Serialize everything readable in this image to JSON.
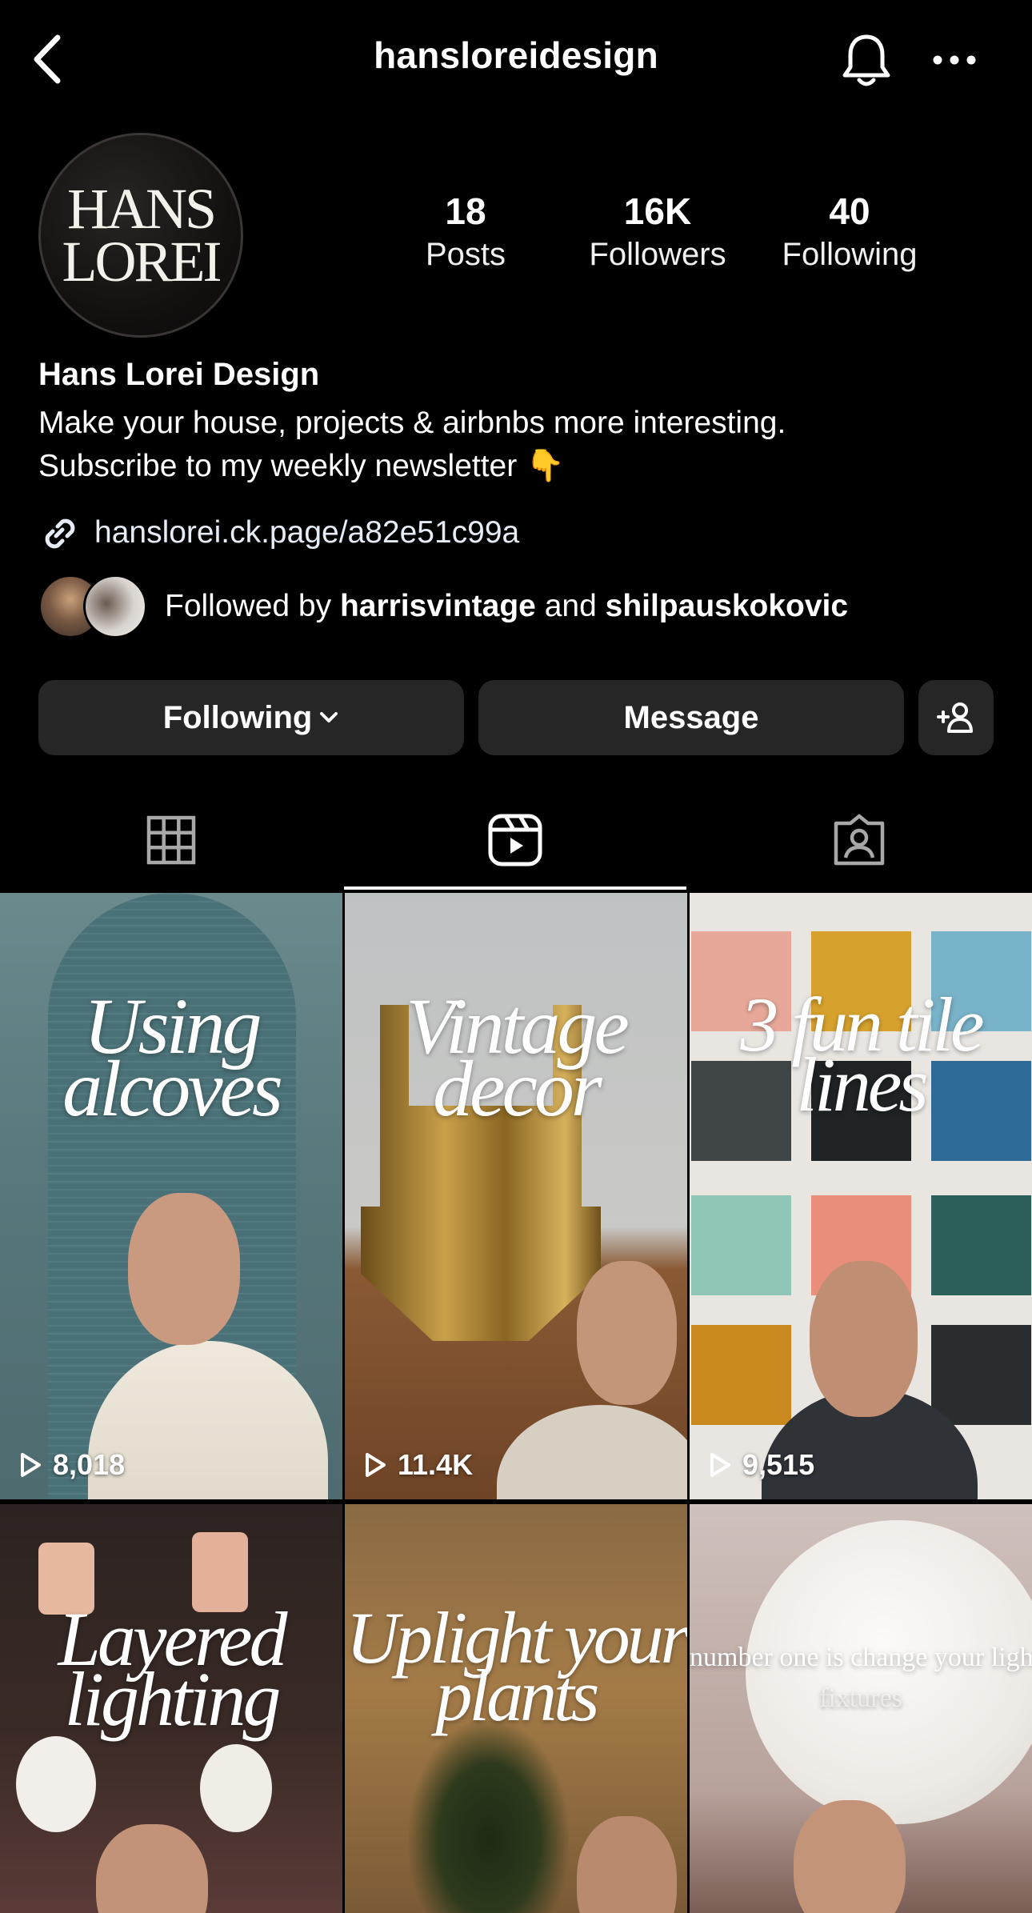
{
  "header": {
    "title": "hansloreidesign",
    "back_icon": "chevron-left-icon",
    "bell_icon": "bell-icon",
    "more_icon": "ellipsis-icon"
  },
  "profile": {
    "avatar_logo_line1": "HANS",
    "avatar_logo_line2": "LOREI",
    "stats": [
      {
        "value": "18",
        "label": "Posts"
      },
      {
        "value": "16K",
        "label": "Followers"
      },
      {
        "value": "40",
        "label": "Following"
      }
    ],
    "name": "Hans Lorei Design",
    "bio_line1": "Make your house, projects & airbnbs more interesting.",
    "bio_line2": "Subscribe to my weekly newsletter 👇",
    "link": "hanslorei.ck.page/a82e51c99a",
    "followed_by_prefix": "Followed by ",
    "followed_by_user1": "harrisvintage",
    "followed_by_and": " and ",
    "followed_by_user2": "shilpauskokovic"
  },
  "actions": {
    "following_label": "Following",
    "message_label": "Message",
    "add_user_icon": "add-person-icon"
  },
  "tabs": [
    {
      "name": "grid",
      "icon": "grid-icon",
      "active": false
    },
    {
      "name": "reels",
      "icon": "reels-icon",
      "active": true
    },
    {
      "name": "tagged",
      "icon": "tagged-icon",
      "active": false
    }
  ],
  "reels": [
    {
      "title_line1": "Using",
      "title_line2": "alcoves",
      "views": "8,018"
    },
    {
      "title_line1": "Vintage",
      "title_line2": "decor",
      "views": "11.4K"
    },
    {
      "title_line1": "3 fun tile",
      "title_line2": "lines",
      "views": "9,515"
    },
    {
      "title_line1": "Layered",
      "title_line2": "lighting"
    },
    {
      "title_line1": "Uplight your",
      "title_line2": "plants"
    },
    {
      "caption_line1": "number one is change your light",
      "caption_line2": "fixtures"
    }
  ],
  "colors": {
    "background": "#000000",
    "button": "#262626",
    "text": "#ffffff"
  }
}
